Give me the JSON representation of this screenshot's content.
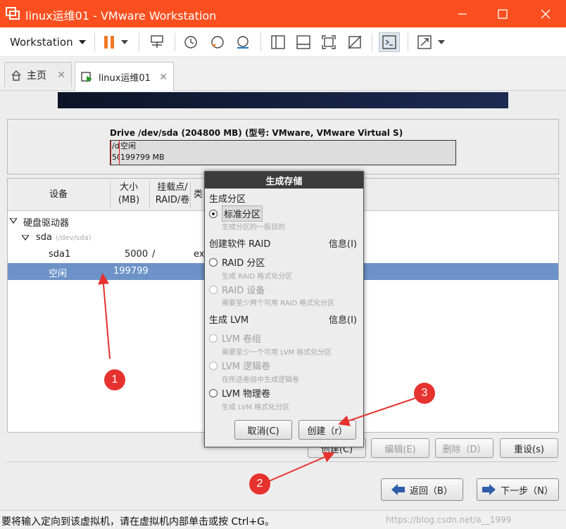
{
  "window": {
    "title": "linux运维01 - VMware Workstation"
  },
  "toolbar": {
    "workstation_label": "Workstation"
  },
  "tabs": [
    {
      "label": "主页"
    },
    {
      "label": "linux运维01"
    }
  ],
  "drive": {
    "title": "Drive /dev/sda (204800 MB) (型号: VMware, VMware Virtual S)",
    "used_label_1": "/d",
    "used_label_2": "50",
    "free_label": "空闲",
    "free_size": "199799 MB"
  },
  "grid": {
    "headers": {
      "device": "设备",
      "size_1": "大小",
      "size_2": "(MB)",
      "mount_1": "挂载点/",
      "mount_2": "RAID/卷",
      "type": "类"
    },
    "tree": {
      "disks": "硬盘驱动器",
      "sda": "sda",
      "sda_path": "(/dev/sda)"
    },
    "rows": [
      {
        "device": "sda1",
        "size": "5000",
        "mount": "/",
        "type": "ex"
      },
      {
        "device": "空闲",
        "size": "199799",
        "mount": "",
        "type": ""
      }
    ]
  },
  "actions": {
    "create": "创建(C)",
    "edit": "编辑(E)",
    "delete": "删除（D）",
    "reset": "重设(s)"
  },
  "nav": {
    "back": "返回（B）",
    "next": "下一步（N）"
  },
  "dialog": {
    "title": "生成存储",
    "sections": {
      "partition": "生成分区",
      "raid": "创建软件 RAID",
      "raid_info": "信息(I)",
      "lvm": "生成 LVM",
      "lvm_info": "信息(I)"
    },
    "options": {
      "standard": {
        "label": "标准分区",
        "desc": "生成分区的一般目的"
      },
      "raid_partition": {
        "label": "RAID 分区",
        "desc": "生成 RAID 格式化分区"
      },
      "raid_device": {
        "label": "RAID 设备",
        "desc": "需要至少两个可用 RAID 格式化分区"
      },
      "lvm_vg": {
        "label": "LVM 卷组",
        "desc": "需要至少一个可用 LVM 格式化分区"
      },
      "lvm_lv": {
        "label": "LVM 逻辑卷",
        "desc": "在所选卷组中生成逻辑卷"
      },
      "lvm_pv": {
        "label": "LVM 物理卷",
        "desc": "生成 LVM 格式化分区"
      }
    },
    "cancel": "取消(C)",
    "create": "创建（r）"
  },
  "status": {
    "message": "要将输入定向到该虚拟机，请在虚拟机内部单击或按 Ctrl+G。",
    "watermark": "https://blog.csdn.net/a__1999"
  },
  "annotations": {
    "one": "1",
    "two": "2",
    "three": "3"
  },
  "colors": {
    "titlebar": "#fb4f1f",
    "selection": "#6d92c7",
    "annotation": "#e6322f",
    "pause": "#f07a26"
  }
}
